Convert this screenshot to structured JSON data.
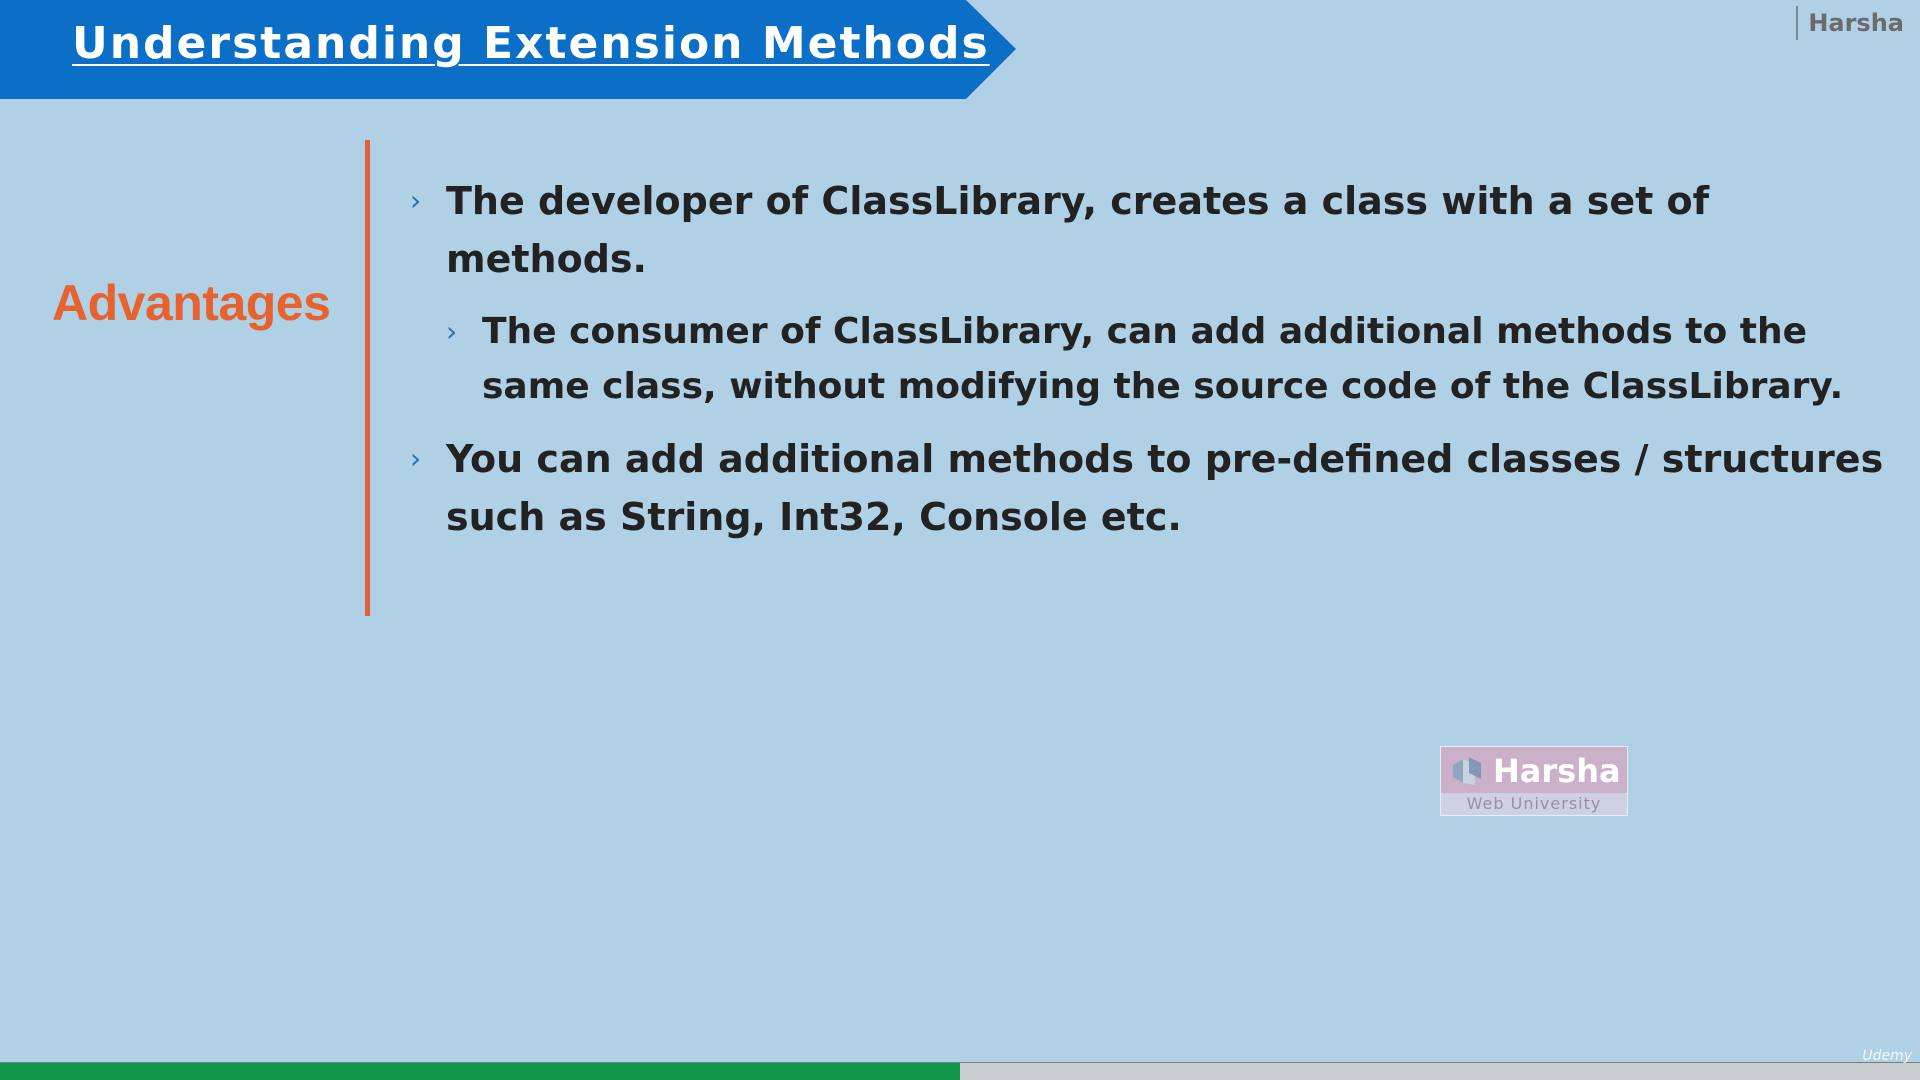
{
  "slide": {
    "title": "Understanding Extension Methods",
    "author_tag": "Harsha",
    "section_label": "Advantages",
    "bullets": [
      {
        "level": 1,
        "text": "The developer of ClassLibrary, creates a class with a set of methods."
      },
      {
        "level": 2,
        "text": "The consumer of ClassLibrary, can add additional methods to the same class, without modifying the source code of the ClassLibrary."
      },
      {
        "level": 1,
        "text": "You can add additional methods to pre-defined classes / structures such as String, Int32, Console etc."
      }
    ],
    "bullet_icon": "chevron-right-icon"
  },
  "watermark": {
    "name": "Harsha",
    "subtitle": "Web University",
    "icon": "harsha-logo-icon"
  },
  "player": {
    "progress_fraction": 0.5,
    "brand": "Udemy"
  },
  "colors": {
    "background": "#b0d0e5",
    "title_banner": "#0b6fc7",
    "accent": "#e8622e",
    "progress": "#12964a"
  }
}
